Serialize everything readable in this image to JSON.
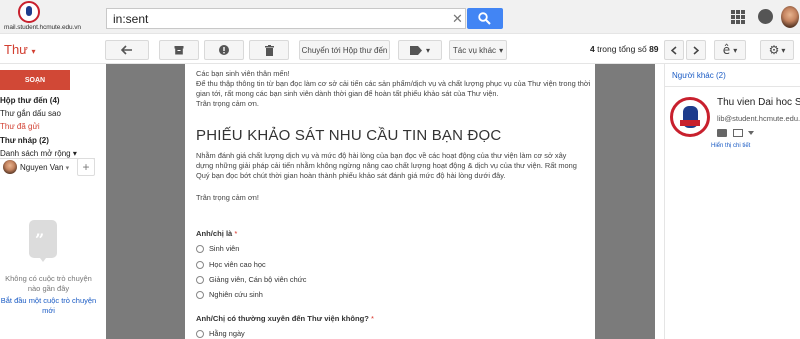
{
  "header": {
    "logo_text": "mail.student.hcmute.edu.vn",
    "search_value": "in:sent"
  },
  "toolbar": {
    "folder_label": "Thư",
    "move_inbox_label": "Chuyển tới Hộp thư đến",
    "more_label": "Tác vụ khác",
    "count_range": "4",
    "count_of": " trong tổng số ",
    "count_total": "89"
  },
  "sidebar": {
    "compose_label": "SOẠN",
    "items": [
      {
        "label": "Hộp thư đến (4)",
        "bold": true,
        "active": false
      },
      {
        "label": "Thư gắn dấu sao",
        "bold": false,
        "active": false
      },
      {
        "label": "Thư đã gửi",
        "bold": false,
        "active": true
      },
      {
        "label": "Thư nháp (2)",
        "bold": true,
        "active": false
      },
      {
        "label": "Danh sách mở rộng ▾",
        "bold": false,
        "active": false
      }
    ],
    "hangouts_user": "Nguyen Van",
    "hangouts_empty": "Không có cuộc trò chuyện nào gần đây",
    "hangouts_start": "Bắt đầu một cuộc trò chuyện mới"
  },
  "message": {
    "greeting": "Các bạn sinh viên thân mến!",
    "intro": "Để thu thập thông tin từ bạn đọc làm cơ sở cải tiến các sản phẩm/dịch vụ và chất lượng phục vụ của Thư viện trong thời gian tới, rất mong các bạn sinh viên dành thời gian để hoàn tất phiếu khảo sát của Thư viện.",
    "thanks1": "Trân trọng cảm ơn.",
    "form_title": "PHIẾU KHẢO SÁT NHU CẦU TIN BẠN ĐỌC",
    "form_desc": "Nhằm đánh giá chất lượng dịch vụ và mức độ hài lòng của bạn đọc về các hoạt động của thư viện làm cơ sở xây dựng những giải pháp cải tiến nhằm không ngừng nâng cao chất lượng hoạt động & dịch vụ của thư viện. Rất mong Quý bạn đọc bớt chút thời gian hoàn thành phiếu khảo sát đánh giá mức độ hài lòng dưới đây.",
    "thanks2": "Trân trọng cảm ơn!",
    "q1": "Anh/chị là",
    "q1_options": [
      "Sinh viên",
      "Học viên cao học",
      "Giảng viên, Cán bộ viên chức",
      "Nghiên cứu sinh"
    ],
    "q2": "Anh/Chị có thường xuyên đến Thư viện không?",
    "q2_options": [
      "Hằng ngày"
    ],
    "required_mark": "*"
  },
  "contact_panel": {
    "others_label": "Người khác (2)",
    "name": "Thu vien Dai hoc Su pham Ky thuat",
    "email": "lib@student.hcmute.edu.vn",
    "detail_link": "Hiển thị chi tiết"
  },
  "colors": {
    "accent_red": "#d14836",
    "link_blue": "#1a5bc4",
    "search_blue": "#4285f4"
  }
}
